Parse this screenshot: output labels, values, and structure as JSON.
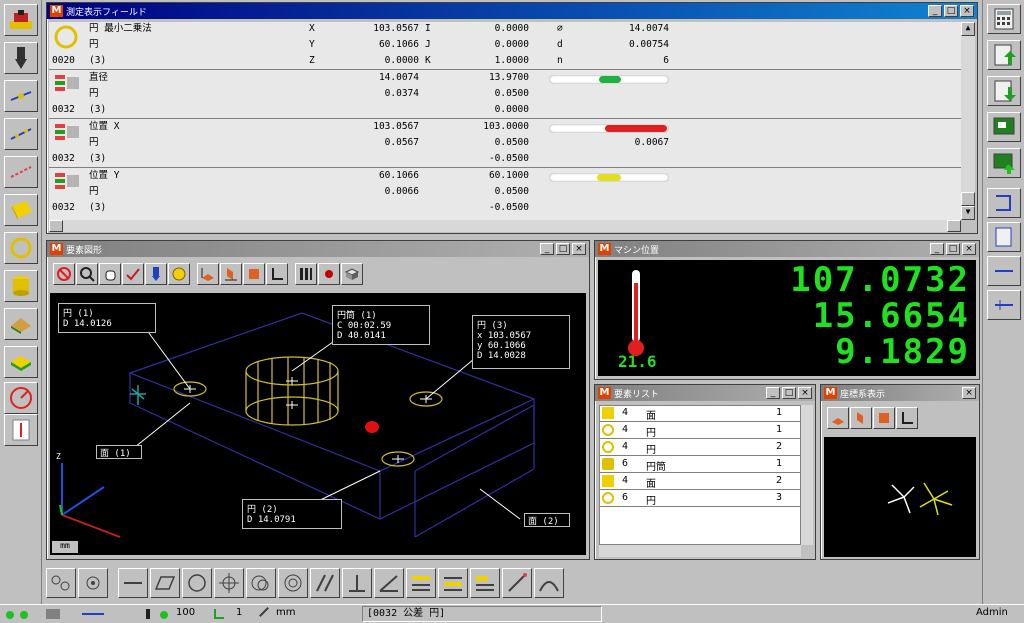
{
  "measure_window": {
    "title": "測定表示フィールド",
    "blocks": [
      {
        "id": "0020",
        "rows": [
          {
            "name": "円 最小二乗法",
            "axis": "X",
            "v1": "103.0567",
            "lbl2": "I",
            "v2": "0.0000",
            "lbl3": "⌀",
            "v3": "14.0074"
          },
          {
            "name": "円",
            "axis": "Y",
            "v1": "60.1066",
            "lbl2": "J",
            "v2": "0.0000",
            "lbl3": "d",
            "v3": "0.00754"
          },
          {
            "name": "(3)",
            "axis": "Z",
            "v1": "0.0000",
            "lbl2": "K",
            "v2": "1.0000",
            "lbl3": "n",
            "v3": "6"
          }
        ]
      },
      {
        "id": "0032",
        "rows": [
          {
            "name": "直径",
            "a": "14.0074",
            "b": "13.9700"
          },
          {
            "name": "円",
            "a": "0.0374",
            "b": "0.0500"
          },
          {
            "name": "(3)",
            "a": "",
            "b": "0.0000"
          }
        ],
        "gauge_color": "#20b040",
        "gauge_level": 0.5
      },
      {
        "id": "0032",
        "rows": [
          {
            "name": "位置 X",
            "a": "103.0567",
            "b": "103.0000"
          },
          {
            "name": "円",
            "a": "0.0567",
            "b": "0.0500"
          },
          {
            "name": "(3)",
            "a": "",
            "b": "-0.0500"
          }
        ],
        "extra": "0.0067",
        "gauge_color": "#e02020",
        "gauge_level": 0.85
      },
      {
        "id": "0032",
        "rows": [
          {
            "name": "位置 Y",
            "a": "60.1066",
            "b": "60.1000"
          },
          {
            "name": "円",
            "a": "0.0066",
            "b": "0.0500"
          },
          {
            "name": "(3)",
            "a": "",
            "b": "-0.0500"
          }
        ],
        "gauge_color": "#e0e020",
        "gauge_level": 0.5
      }
    ]
  },
  "view_window": {
    "title": "要素図形",
    "callouts": {
      "c1": {
        "line1": "円 (1)",
        "line2": "D 14.0126"
      },
      "c2": {
        "line1": "円筒 (1)",
        "line2a": "C 00:02.59",
        "line2b": "D 40.0141"
      },
      "c3": {
        "line1": "円 (3)",
        "x": "x 103.0567",
        "y": "y 60.1066",
        "d": "D 14.0028"
      },
      "c4": {
        "line1": "面 (1)"
      },
      "c5": {
        "line1": "円 (2)",
        "line2": "D 14.0791"
      },
      "c6": {
        "line1": "面 (2)"
      }
    },
    "status_label": "mm"
  },
  "counter_window": {
    "title": "マシン位置",
    "x": "107.0732",
    "y": "15.6654",
    "z": "9.1829",
    "temperature": "21.6",
    "temp_level": 0.85
  },
  "list_window": {
    "title": "要素リスト",
    "rows": [
      {
        "idx": "4",
        "name": "面",
        "count": "1"
      },
      {
        "idx": "4",
        "name": "円",
        "count": "1"
      },
      {
        "idx": "4",
        "name": "円",
        "count": "2"
      },
      {
        "idx": "6",
        "name": "円筒",
        "count": "1"
      },
      {
        "idx": "4",
        "name": "面",
        "count": "2"
      },
      {
        "idx": "6",
        "name": "円",
        "count": "3"
      }
    ]
  },
  "coord_window": {
    "title": "座標系表示"
  },
  "statusbar": {
    "count": "100",
    "axis": "1",
    "unit": "mm",
    "message": "[0032 公差 円]",
    "user": "Admin"
  }
}
